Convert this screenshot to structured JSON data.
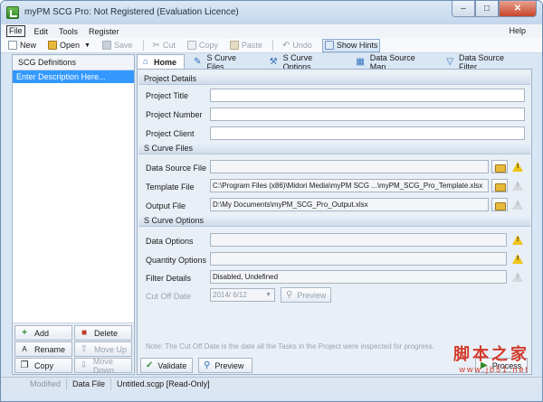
{
  "window": {
    "title": "myPM SCG Pro: Not Registered (Evaluation Licence)",
    "min_glyph": "–",
    "max_glyph": "□",
    "close_glyph": "✕"
  },
  "menu": {
    "items": [
      "File",
      "Edit",
      "Tools",
      "Register"
    ],
    "help": "Help"
  },
  "toolbar": {
    "new": "New",
    "open": "Open",
    "save": "Save",
    "cut": "Cut",
    "copy": "Copy",
    "paste": "Paste",
    "undo": "Undo",
    "show_hints": "Show Hints"
  },
  "left_panel": {
    "header": "SCG Definitions",
    "selected_item": "Enter Description Here...",
    "buttons": {
      "add": "Add",
      "delete": "Delete",
      "rename": "Rename",
      "move_up": "Move Up",
      "copy": "Copy",
      "move_down": "Move Down"
    }
  },
  "tabs": [
    "Home",
    "S Curve Files",
    "S Curve Options",
    "Data Source Map",
    "Data Source Filter"
  ],
  "sections": {
    "project_details": "Project Details",
    "s_curve_files": "S Curve Files",
    "s_curve_options": "S Curve Options"
  },
  "fields": {
    "project_title": {
      "label": "Project Title",
      "value": ""
    },
    "project_number": {
      "label": "Project Number",
      "value": ""
    },
    "project_client": {
      "label": "Project Client",
      "value": ""
    },
    "data_source_file": {
      "label": "Data Source File",
      "value": ""
    },
    "template_file": {
      "label": "Template File",
      "value": "C:\\Program Files (x86)\\Midori Media\\myPM SCG ...\\myPM_SCG_Pro_Template.xlsx"
    },
    "output_file": {
      "label": "Output File",
      "value": "D:\\My Documents\\myPM_SCG_Pro_Output.xlsx"
    },
    "data_options": {
      "label": "Data Options",
      "value": ""
    },
    "quantity_options": {
      "label": "Quantity Options",
      "value": ""
    },
    "filter_details": {
      "label": "Filter Details",
      "value": "Disabled, Undefined"
    },
    "cut_off_date": {
      "label": "Cut Off Date",
      "value": "2014/  6/12"
    }
  },
  "preview_small": "Preview",
  "note": "Note: The Cut Off Date is the date all the Tasks in the Project were inspected for progress.",
  "bottom_buttons": {
    "validate": "Validate",
    "preview": "Preview",
    "process": "Process"
  },
  "status": {
    "modified": "Modified",
    "data_file": "Data File",
    "file": "Untitled.scgp [Read-Only]"
  },
  "watermark": {
    "main": "脚本之家",
    "sub": "www.jb51.net"
  },
  "colors": {
    "selection": "#3399ff",
    "warning": "#f0c419",
    "accent": "#2f6fbf"
  }
}
